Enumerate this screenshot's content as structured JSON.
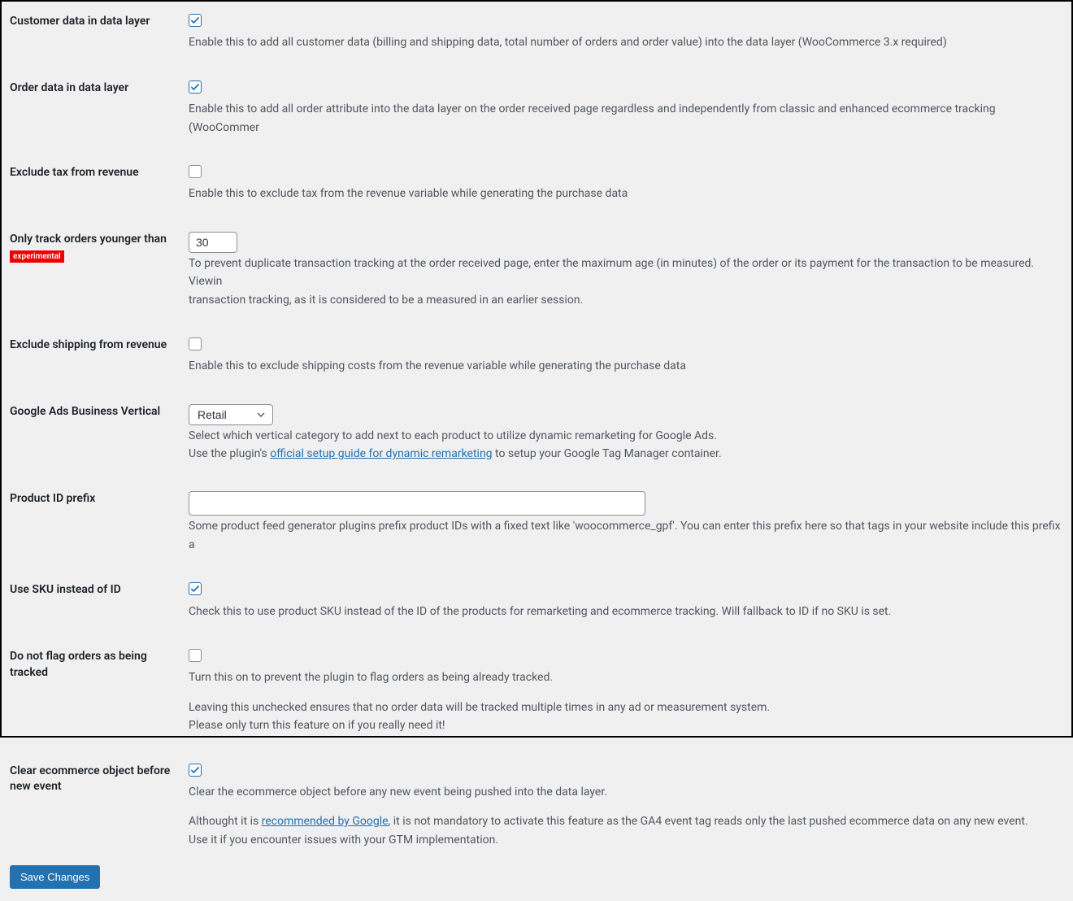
{
  "rows": {
    "customer_data": {
      "label": "Customer data in data layer",
      "checked": true,
      "description": "Enable this to add all customer data (billing and shipping data, total number of orders and order value) into the data layer (WooCommerce 3.x required)"
    },
    "order_data": {
      "label": "Order data in data layer",
      "checked": true,
      "description": "Enable this to add all order attribute into the data layer on the order received page regardless and independently from classic and enhanced ecommerce tracking (WooCommer"
    },
    "exclude_tax": {
      "label": "Exclude tax from revenue",
      "checked": false,
      "description": "Enable this to exclude tax from the revenue variable while generating the purchase data"
    },
    "order_max_age": {
      "label": "Only track orders younger than",
      "badge": "experimental",
      "value": "30",
      "description": "To prevent duplicate transaction tracking at the order received page, enter the maximum age (in minutes) of the order or its payment for the transaction to be measured. Viewin",
      "description2": "transaction tracking, as it is considered to be a measured in an earlier session."
    },
    "exclude_shipping": {
      "label": "Exclude shipping from revenue",
      "checked": false,
      "description": "Enable this to exclude shipping costs from the revenue variable while generating the purchase data"
    },
    "business_vertical": {
      "label": "Google Ads Business Vertical",
      "value": "Retail",
      "description1": "Select which vertical category to add next to each product to utilize dynamic remarketing for Google Ads.",
      "description2_pre": "Use the plugin's ",
      "description2_link": "official setup guide for dynamic remarketing",
      "description2_post": " to setup your Google Tag Manager container."
    },
    "product_id_prefix": {
      "label": "Product ID prefix",
      "value": "",
      "description": "Some product feed generator plugins prefix product IDs with a fixed text like 'woocommerce_gpf'. You can enter this prefix here so that tags in your website include this prefix a"
    },
    "use_sku": {
      "label": "Use SKU instead of ID",
      "checked": true,
      "description": "Check this to use product SKU instead of the ID of the products for remarketing and ecommerce tracking. Will fallback to ID if no SKU is set."
    },
    "do_not_flag": {
      "label": "Do not flag orders as being tracked",
      "checked": false,
      "description": "Turn this on to prevent the plugin to flag orders as being already tracked.",
      "description2": "Leaving this unchecked ensures that no order data will be tracked multiple times in any ad or measurement system.",
      "description3": "Please only turn this feature on if you really need it!"
    },
    "clear_ecommerce": {
      "label": "Clear ecommerce object before new event",
      "checked": true,
      "description": "Clear the ecommerce object before any new event being pushed into the data layer.",
      "description2_pre": "Althought it is ",
      "description2_link": "recommended by Google",
      "description2_post": ", it is not mandatory to activate this feature as the GA4 event tag reads only the last pushed ecommerce data on any new event.",
      "description3": "Use it if you encounter issues with your GTM implementation."
    }
  },
  "submit": {
    "label": "Save Changes"
  }
}
